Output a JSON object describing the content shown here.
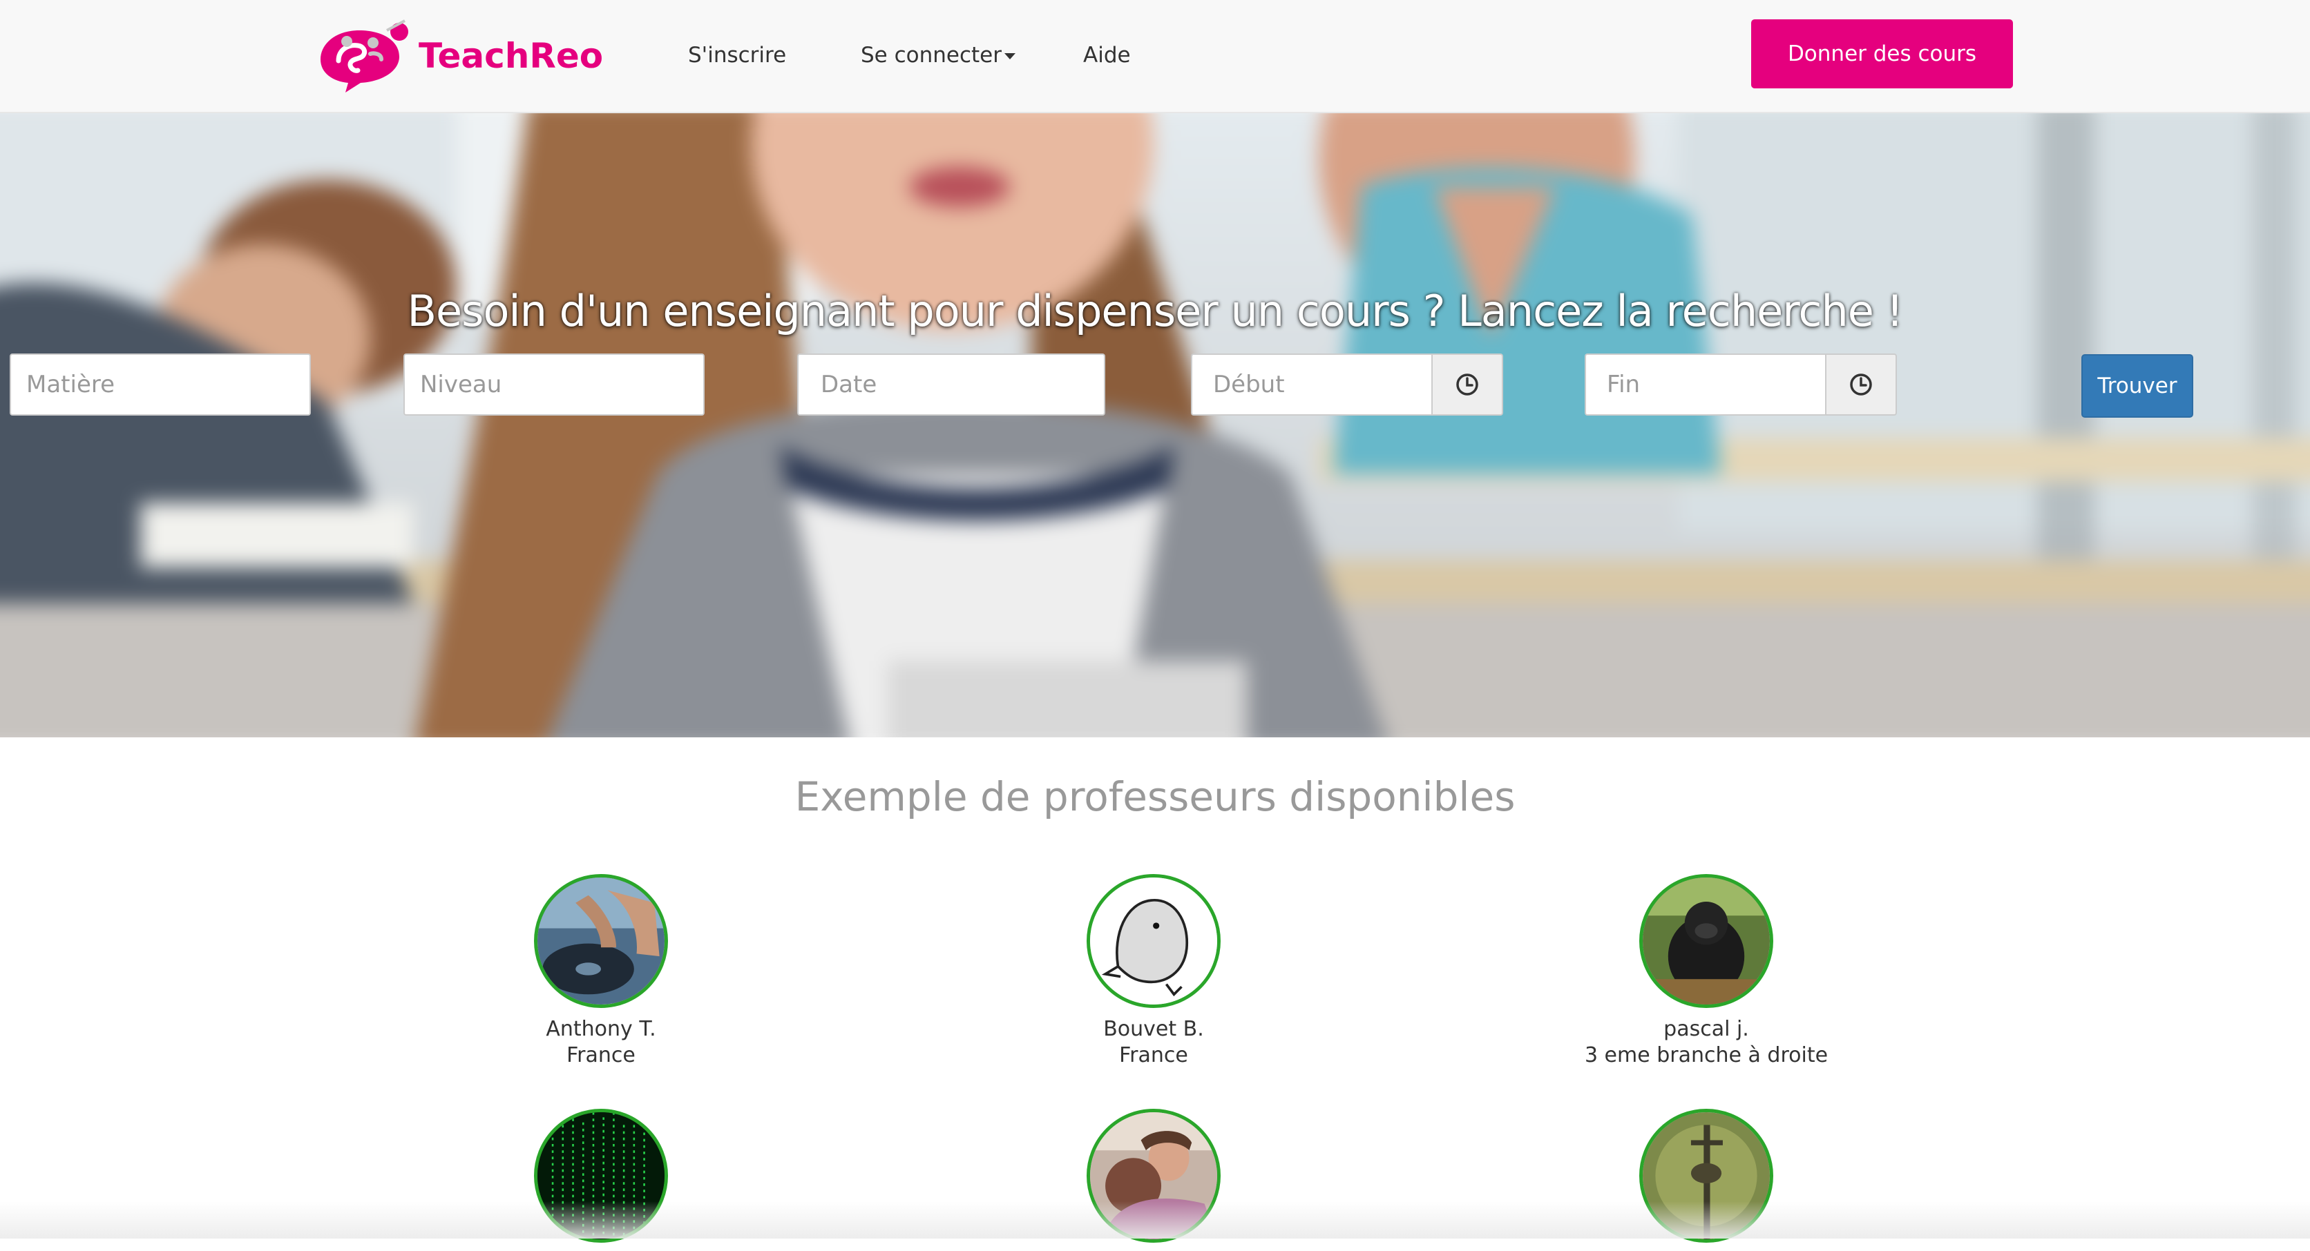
{
  "brand": {
    "name": "TeachReo",
    "color": "#e5007e"
  },
  "nav": {
    "signup": "S'inscrire",
    "login": "Se connecter",
    "help": "Aide",
    "cta": "Donner des cours"
  },
  "hero": {
    "title": "Besoin d'un enseignant pour dispenser un cours ? Lancez la recherche !",
    "subject_placeholder": "Matière",
    "level_placeholder": "Niveau",
    "date_placeholder": "Date",
    "start_placeholder": "Début",
    "end_placeholder": "Fin",
    "search_button": "Trouver"
  },
  "teachers": {
    "title": "Exemple de professeurs disponibles",
    "items": [
      {
        "name": "Anthony T.",
        "location": "France",
        "avatar": "turntable-photo"
      },
      {
        "name": "Bouvet B.",
        "location": "France",
        "avatar": "bird-drawing"
      },
      {
        "name": "pascal j.",
        "location": "3 eme branche à droite",
        "avatar": "monkey-photo"
      },
      {
        "name": "",
        "location": "",
        "avatar": "matrix-code"
      },
      {
        "name": "",
        "location": "",
        "avatar": "hug-photo"
      },
      {
        "name": "",
        "location": "",
        "avatar": "forest-photo"
      }
    ]
  },
  "colors": {
    "accent": "#e5007e",
    "primary": "#337ab7",
    "avatar_border": "#2aa62a"
  }
}
